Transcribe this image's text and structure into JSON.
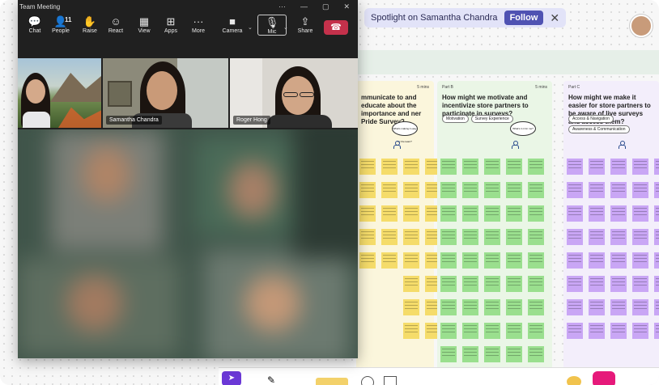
{
  "window": {
    "title": "Team Meeting",
    "window_controls": [
      "···",
      "—",
      "▢",
      "✕"
    ]
  },
  "toolbar": [
    {
      "label": "Chat",
      "icon": "chat-icon",
      "glyph": "💬"
    },
    {
      "label": "People",
      "icon": "people-icon",
      "glyph": "👤",
      "count": "11"
    },
    {
      "label": "Raise",
      "icon": "raise-hand-icon",
      "glyph": "✋"
    },
    {
      "label": "React",
      "icon": "react-icon",
      "glyph": "☺"
    },
    {
      "label": "View",
      "icon": "view-icon",
      "glyph": "▦"
    },
    {
      "label": "Apps",
      "icon": "apps-icon",
      "glyph": "⊞"
    },
    {
      "label": "More",
      "icon": "more-icon",
      "glyph": "···"
    },
    {
      "label": "Camera",
      "icon": "camera-icon",
      "glyph": "■"
    },
    {
      "label": "Mic",
      "icon": "mic-off-icon",
      "glyph": "🎙"
    },
    {
      "label": "Share",
      "icon": "share-icon",
      "glyph": "⇪"
    }
  ],
  "participants": [
    {
      "name": ""
    },
    {
      "name": "Samantha Chandra"
    },
    {
      "name": "Roger Hong"
    }
  ],
  "spotlight": {
    "text": "Spotlight on Samantha Chandra",
    "follow_label": "Follow",
    "close_glyph": "✕"
  },
  "board": {
    "columns": [
      {
        "part": "",
        "mins": "5 mins",
        "question": "mmunicate to and educate about the importance and ner Pride Survey?",
        "chips": [],
        "bubble": "What's making it easy for the team?",
        "color": "#fbf6dc"
      },
      {
        "part": "Part B",
        "mins": "5 mins",
        "question": "How might we motivate and incentivize store partners to participate in surveys?",
        "chips": [
          "Motivation",
          "Survey Experience"
        ],
        "bubble": "What's in it for me?",
        "color": "#eaf6e6"
      },
      {
        "part": "Part C",
        "mins": "",
        "question": "How might we make it easier for store partners to be aware of live surveys and access them?",
        "chips": [
          "Access & Navigation",
          "Awareness & Communication"
        ],
        "bubble": "",
        "color": "#f3eefb"
      }
    ]
  },
  "colors": {
    "accent": "#4f52b2",
    "leave": "#c4314b",
    "sticky_yellow": "#f5dc6a",
    "sticky_green": "#9adf8e",
    "sticky_purple": "#c9a6f5"
  }
}
